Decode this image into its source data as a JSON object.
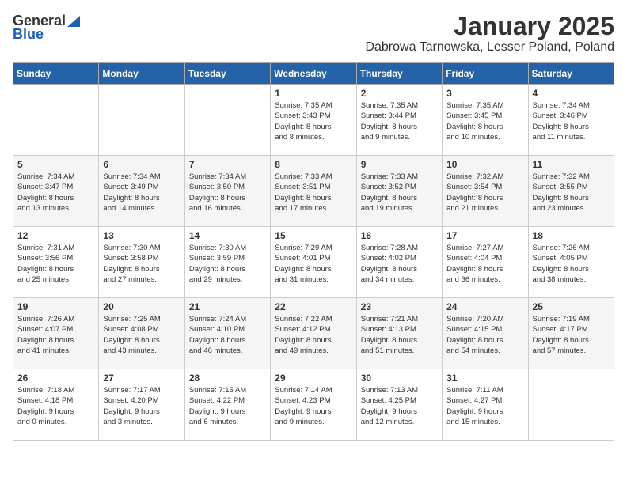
{
  "logo": {
    "general": "General",
    "blue": "Blue"
  },
  "title": "January 2025",
  "subtitle": "Dabrowa Tarnowska, Lesser Poland, Poland",
  "days_of_week": [
    "Sunday",
    "Monday",
    "Tuesday",
    "Wednesday",
    "Thursday",
    "Friday",
    "Saturday"
  ],
  "weeks": [
    [
      {
        "num": "",
        "detail": ""
      },
      {
        "num": "",
        "detail": ""
      },
      {
        "num": "",
        "detail": ""
      },
      {
        "num": "1",
        "detail": "Sunrise: 7:35 AM\nSunset: 3:43 PM\nDaylight: 8 hours\nand 8 minutes."
      },
      {
        "num": "2",
        "detail": "Sunrise: 7:35 AM\nSunset: 3:44 PM\nDaylight: 8 hours\nand 9 minutes."
      },
      {
        "num": "3",
        "detail": "Sunrise: 7:35 AM\nSunset: 3:45 PM\nDaylight: 8 hours\nand 10 minutes."
      },
      {
        "num": "4",
        "detail": "Sunrise: 7:34 AM\nSunset: 3:46 PM\nDaylight: 8 hours\nand 11 minutes."
      }
    ],
    [
      {
        "num": "5",
        "detail": "Sunrise: 7:34 AM\nSunset: 3:47 PM\nDaylight: 8 hours\nand 13 minutes."
      },
      {
        "num": "6",
        "detail": "Sunrise: 7:34 AM\nSunset: 3:49 PM\nDaylight: 8 hours\nand 14 minutes."
      },
      {
        "num": "7",
        "detail": "Sunrise: 7:34 AM\nSunset: 3:50 PM\nDaylight: 8 hours\nand 16 minutes."
      },
      {
        "num": "8",
        "detail": "Sunrise: 7:33 AM\nSunset: 3:51 PM\nDaylight: 8 hours\nand 17 minutes."
      },
      {
        "num": "9",
        "detail": "Sunrise: 7:33 AM\nSunset: 3:52 PM\nDaylight: 8 hours\nand 19 minutes."
      },
      {
        "num": "10",
        "detail": "Sunrise: 7:32 AM\nSunset: 3:54 PM\nDaylight: 8 hours\nand 21 minutes."
      },
      {
        "num": "11",
        "detail": "Sunrise: 7:32 AM\nSunset: 3:55 PM\nDaylight: 8 hours\nand 23 minutes."
      }
    ],
    [
      {
        "num": "12",
        "detail": "Sunrise: 7:31 AM\nSunset: 3:56 PM\nDaylight: 8 hours\nand 25 minutes."
      },
      {
        "num": "13",
        "detail": "Sunrise: 7:30 AM\nSunset: 3:58 PM\nDaylight: 8 hours\nand 27 minutes."
      },
      {
        "num": "14",
        "detail": "Sunrise: 7:30 AM\nSunset: 3:59 PM\nDaylight: 8 hours\nand 29 minutes."
      },
      {
        "num": "15",
        "detail": "Sunrise: 7:29 AM\nSunset: 4:01 PM\nDaylight: 8 hours\nand 31 minutes."
      },
      {
        "num": "16",
        "detail": "Sunrise: 7:28 AM\nSunset: 4:02 PM\nDaylight: 8 hours\nand 34 minutes."
      },
      {
        "num": "17",
        "detail": "Sunrise: 7:27 AM\nSunset: 4:04 PM\nDaylight: 8 hours\nand 36 minutes."
      },
      {
        "num": "18",
        "detail": "Sunrise: 7:26 AM\nSunset: 4:05 PM\nDaylight: 8 hours\nand 38 minutes."
      }
    ],
    [
      {
        "num": "19",
        "detail": "Sunrise: 7:26 AM\nSunset: 4:07 PM\nDaylight: 8 hours\nand 41 minutes."
      },
      {
        "num": "20",
        "detail": "Sunrise: 7:25 AM\nSunset: 4:08 PM\nDaylight: 8 hours\nand 43 minutes."
      },
      {
        "num": "21",
        "detail": "Sunrise: 7:24 AM\nSunset: 4:10 PM\nDaylight: 8 hours\nand 46 minutes."
      },
      {
        "num": "22",
        "detail": "Sunrise: 7:22 AM\nSunset: 4:12 PM\nDaylight: 8 hours\nand 49 minutes."
      },
      {
        "num": "23",
        "detail": "Sunrise: 7:21 AM\nSunset: 4:13 PM\nDaylight: 8 hours\nand 51 minutes."
      },
      {
        "num": "24",
        "detail": "Sunrise: 7:20 AM\nSunset: 4:15 PM\nDaylight: 8 hours\nand 54 minutes."
      },
      {
        "num": "25",
        "detail": "Sunrise: 7:19 AM\nSunset: 4:17 PM\nDaylight: 8 hours\nand 57 minutes."
      }
    ],
    [
      {
        "num": "26",
        "detail": "Sunrise: 7:18 AM\nSunset: 4:18 PM\nDaylight: 9 hours\nand 0 minutes."
      },
      {
        "num": "27",
        "detail": "Sunrise: 7:17 AM\nSunset: 4:20 PM\nDaylight: 9 hours\nand 3 minutes."
      },
      {
        "num": "28",
        "detail": "Sunrise: 7:15 AM\nSunset: 4:22 PM\nDaylight: 9 hours\nand 6 minutes."
      },
      {
        "num": "29",
        "detail": "Sunrise: 7:14 AM\nSunset: 4:23 PM\nDaylight: 9 hours\nand 9 minutes."
      },
      {
        "num": "30",
        "detail": "Sunrise: 7:13 AM\nSunset: 4:25 PM\nDaylight: 9 hours\nand 12 minutes."
      },
      {
        "num": "31",
        "detail": "Sunrise: 7:11 AM\nSunset: 4:27 PM\nDaylight: 9 hours\nand 15 minutes."
      },
      {
        "num": "",
        "detail": ""
      }
    ]
  ]
}
